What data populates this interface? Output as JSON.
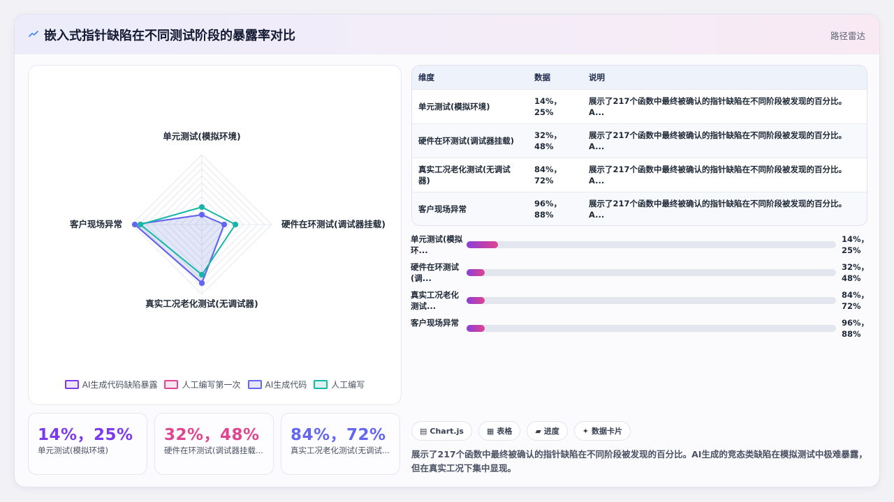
{
  "header": {
    "title": "嵌入式指针缺陷在不同测试阶段的暴露率对比",
    "tag": "路径雷达"
  },
  "chart_data": {
    "type": "radar",
    "axes": [
      "单元测试(模拟环境)",
      "硬件在环测试(调试器挂载)",
      "真实工况老化测试(无调试器)",
      "客户现场异常"
    ],
    "series": [
      {
        "name": "AI生成代码缺陷暴露",
        "values": [
          14,
          32,
          84,
          96
        ],
        "color": "#7c5ce0"
      },
      {
        "name": "人工编写第一次",
        "values": [
          25,
          48,
          72,
          88
        ],
        "color": "#e0448f"
      },
      {
        "name": "AI生成代码",
        "values": [
          14,
          32,
          84,
          96
        ],
        "color": "#6366f1"
      },
      {
        "name": "人工编写",
        "values": [
          25,
          48,
          72,
          88
        ],
        "color": "#14b8a6"
      }
    ],
    "range": [
      0,
      100
    ]
  },
  "legend": [
    {
      "label": "AI生成代码缺陷暴露",
      "color": "#7c3aed",
      "fill": "#ede6fb"
    },
    {
      "label": "人工编写第一次",
      "color": "#e0448f",
      "fill": "#fbe4ef"
    },
    {
      "label": "AI生成代码",
      "color": "#6366f1",
      "fill": "#e6e7fb"
    },
    {
      "label": "人工编写",
      "color": "#14b8a6",
      "fill": "#dcf3f0"
    }
  ],
  "stats": [
    {
      "value": "14%，25%",
      "label": "单元测试(模拟环境)",
      "color": "#7c3aed"
    },
    {
      "value": "32%，48%",
      "label": "硬件在环测试(调试器挂载...",
      "color": "#e0448f"
    },
    {
      "value": "84%，72%",
      "label": "真实工况老化测试(无调试...",
      "color": "#6366f1"
    }
  ],
  "table": {
    "headers": [
      "维度",
      "数据",
      "说明"
    ],
    "rows": [
      {
        "dim": "单元测试(模拟环境)",
        "data": "14%，25%",
        "note": "展示了217个函数中最终被确认的指针缺陷在不同阶段被发现的百分比。A..."
      },
      {
        "dim": "硬件在环测试(调试器挂载)",
        "data": "32%，48%",
        "note": "展示了217个函数中最终被确认的指针缺陷在不同阶段被发现的百分比。A..."
      },
      {
        "dim": "真实工况老化测试(无调试器)",
        "data": "84%，72%",
        "note": "展示了217个函数中最终被确认的指针缺陷在不同阶段被发现的百分比。A..."
      },
      {
        "dim": "客户现场异常",
        "data": "96%，88%",
        "note": "展示了217个函数中最终被确认的指针缺陷在不同阶段被发现的百分比。A..."
      }
    ]
  },
  "progress": [
    {
      "label": "单元测试(模拟环...",
      "value": "14%，25%",
      "fill": 0.086
    },
    {
      "label": "硬件在环测试(调...",
      "value": "32%，48%",
      "fill": 0.05
    },
    {
      "label": "真实工况老化测试...",
      "value": "84%，72%",
      "fill": 0.05
    },
    {
      "label": "客户现场异常",
      "value": "96%，88%",
      "fill": 0.05
    }
  ],
  "pills": [
    {
      "icon": "▤",
      "label": "Chart.js"
    },
    {
      "icon": "▦",
      "label": "表格"
    },
    {
      "icon": "▰",
      "label": "进度"
    },
    {
      "icon": "✦",
      "label": "数据卡片"
    }
  ],
  "description": "展示了217个函数中最终被确认的指针缺陷在不同阶段被发现的百分比。AI生成的竞态类缺陷在模拟测试中极难暴露，但在真实工况下集中显现。"
}
